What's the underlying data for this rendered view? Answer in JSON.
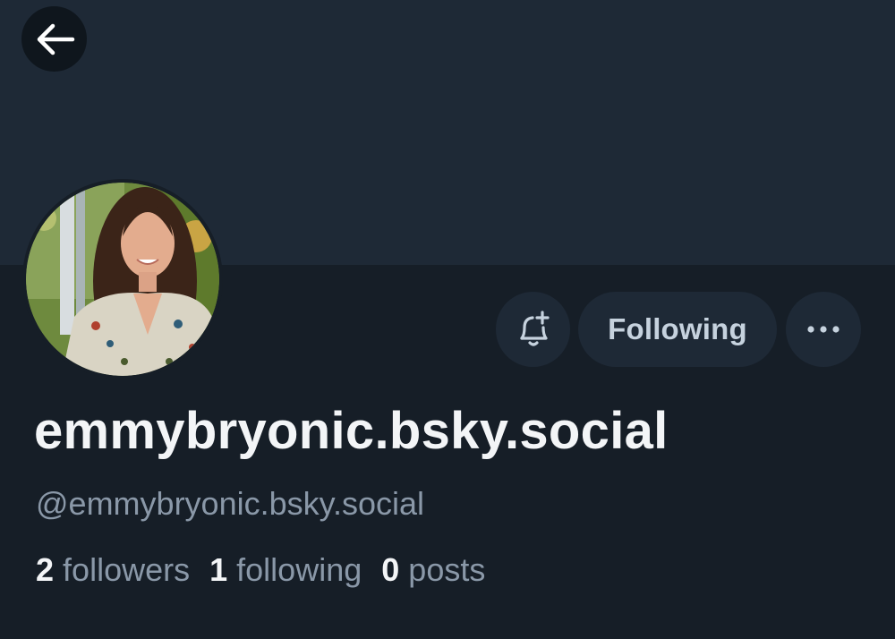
{
  "profile": {
    "display_name": "emmybryonic.bsky.social",
    "handle": "@emmybryonic.bsky.social",
    "stats": [
      {
        "count": "2",
        "label": "followers"
      },
      {
        "count": "1",
        "label": "following"
      },
      {
        "count": "0",
        "label": "posts"
      }
    ]
  },
  "actions": {
    "following_label": "Following"
  },
  "icons": {
    "back": "arrow-left-icon",
    "bell": "bell-plus-icon",
    "more": "ellipsis-icon"
  },
  "colors": {
    "background": "#161e27",
    "banner": "#1e2936",
    "button_bg": "#1e2936",
    "text_primary": "#f3f5f7",
    "text_secondary": "#8a98a8"
  }
}
